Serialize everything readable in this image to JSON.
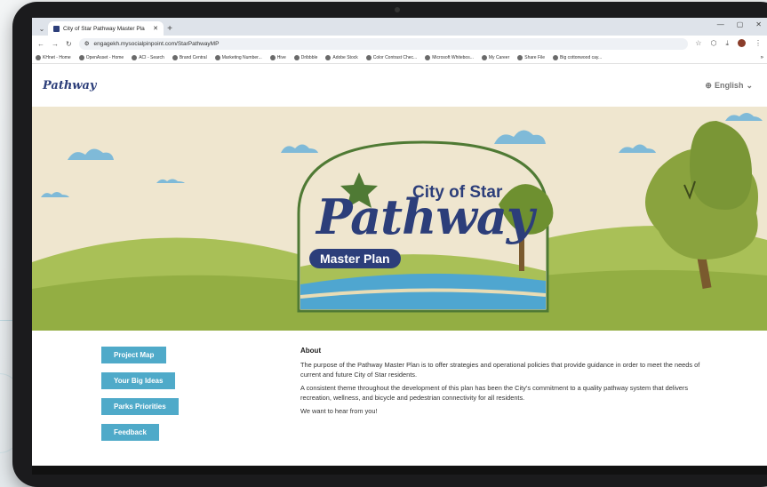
{
  "browser": {
    "tab_title": "City of Star Pathway Master Pla",
    "url": "engagekh.mysocialpinpoint.com/StarPathwayMP",
    "bookmarks": [
      "KHnet - Home",
      "OpenAsset - Home",
      "ACI - Search",
      "Brand Central",
      "Marketing Number...",
      "Hive",
      "Dribbble",
      "Adobe Stock",
      "Color Contrast Chec...",
      "Microsoft Whitebos...",
      "My Career",
      "Share File",
      "Big cottonwood cay..."
    ],
    "bookmarks_more": "»"
  },
  "site": {
    "logo_text": "Pathway",
    "language": "English"
  },
  "hero": {
    "city_text": "City of Star",
    "pathway_text": "Pathway",
    "master_plan_text": "Master Plan"
  },
  "nav": {
    "project_map": "Project Map",
    "big_ideas": "Your Big Ideas",
    "parks_priorities": "Parks Priorities",
    "feedback": "Feedback"
  },
  "about": {
    "heading": "About",
    "p1": "The purpose of the Pathway Master Plan is to offer strategies and operational policies that provide guidance in order to meet the needs of current and future City of Star residents.",
    "p2": "A consistent theme throughout the development of this plan has been the City's commitment to a quality pathway system that delivers recreation, wellness, and bicycle and pedestrian connectivity for all residents.",
    "p3": "We want to hear from you!"
  },
  "colors": {
    "brand_navy": "#2c3e7a",
    "button_blue": "#4faac9",
    "hill_green": "#9bb34a",
    "sand": "#efe6cf"
  }
}
